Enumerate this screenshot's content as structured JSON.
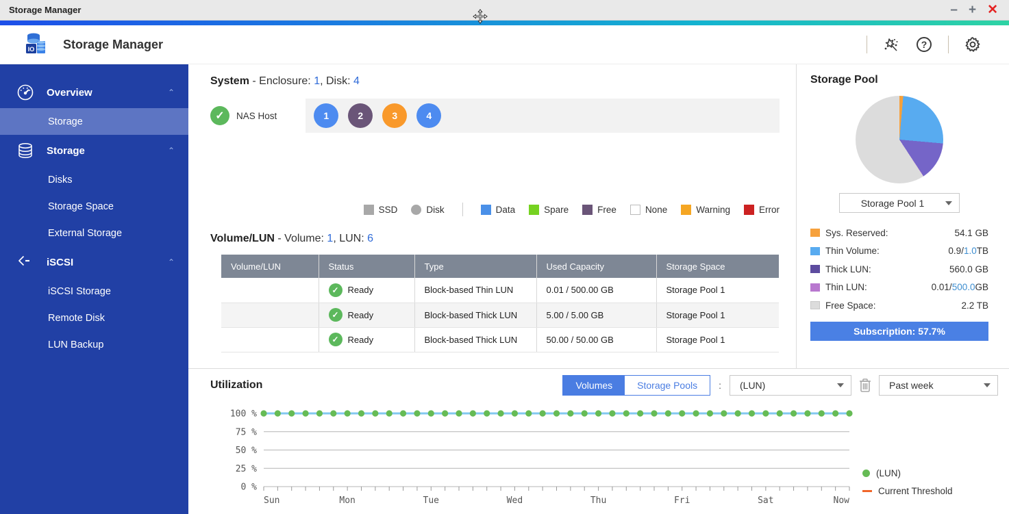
{
  "window": {
    "title": "Storage Manager",
    "controls": [
      {
        "name": "minimize",
        "glyph": "–"
      },
      {
        "name": "maximize",
        "glyph": "+"
      },
      {
        "name": "close",
        "glyph": "✕"
      }
    ]
  },
  "header": {
    "app_title": "Storage Manager",
    "help_glyph": "?",
    "icons": [
      "wizard-icon",
      "help-icon",
      "settings-icon"
    ]
  },
  "sidebar": {
    "bg_color": "#2140a5",
    "selected_color": "#5d75c3",
    "sections": [
      {
        "label": "Overview",
        "icon": "gauge-icon",
        "expanded": true,
        "children": [
          {
            "label": "Storage",
            "selected": true
          }
        ]
      },
      {
        "label": "Storage",
        "icon": "disks-icon",
        "expanded": true,
        "children": [
          {
            "label": "Disks",
            "selected": false
          },
          {
            "label": "Storage Space",
            "selected": false
          },
          {
            "label": "External Storage",
            "selected": false
          }
        ]
      },
      {
        "label": "iSCSI",
        "icon": "iscsi-icon",
        "expanded": true,
        "children": [
          {
            "label": "iSCSI Storage",
            "selected": false
          },
          {
            "label": "Remote Disk",
            "selected": false
          },
          {
            "label": "LUN Backup",
            "selected": false
          }
        ]
      }
    ]
  },
  "system": {
    "title": "System",
    "subtitle_prefix": " - Enclosure: ",
    "enclosure_count": "1",
    "disk_label": ", Disk: ",
    "disk_count": "4",
    "nas_host_label": "NAS Host",
    "nas_host_status_ok": "✓",
    "disks": [
      {
        "number": "1",
        "color": "#4d8bf0"
      },
      {
        "number": "2",
        "color": "#6a5578"
      },
      {
        "number": "3",
        "color": "#f9992b"
      },
      {
        "number": "4",
        "color": "#4d8bf0"
      }
    ],
    "legend": [
      {
        "label": "SSD",
        "shape": "square",
        "color": "#a8a8a8",
        "border": ""
      },
      {
        "label": "Disk",
        "shape": "circle",
        "color": "#a8a8a8",
        "border": ""
      },
      {
        "label": "Data",
        "shape": "square",
        "color": "#4a90e8",
        "border": "",
        "divider_before": true
      },
      {
        "label": "Spare",
        "shape": "square",
        "color": "#76d221",
        "border": ""
      },
      {
        "label": "Free",
        "shape": "square",
        "color": "#6a5578",
        "border": ""
      },
      {
        "label": "None",
        "shape": "square",
        "color": "#ffffff",
        "border": "#bbbbbb"
      },
      {
        "label": "Warning",
        "shape": "square",
        "color": "#f5a623",
        "border": ""
      },
      {
        "label": "Error",
        "shape": "square",
        "color": "#cc2222",
        "border": ""
      }
    ]
  },
  "volume_lun": {
    "title": "Volume/LUN",
    "subtitle_prefix": " - Volume: ",
    "volume_count": "1",
    "lun_label": ", LUN: ",
    "lun_count": "6",
    "table": {
      "columns": [
        "Volume/LUN",
        "Status",
        "Type",
        "Used Capacity",
        "Storage Space"
      ],
      "status_ok_glyph": "✓",
      "rows": [
        {
          "name": "",
          "status": "Ready",
          "type": "Block-based Thin LUN",
          "used": "0.01 / 500.00 GB",
          "space": "Storage Pool 1"
        },
        {
          "name": "",
          "status": "Ready",
          "type": "Block-based Thick LUN",
          "used": "5.00 / 5.00 GB",
          "space": "Storage Pool 1"
        },
        {
          "name": "",
          "status": "Ready",
          "type": "Block-based Thick LUN",
          "used": "50.00 / 50.00 GB",
          "space": "Storage Pool 1"
        }
      ]
    }
  },
  "storage_pool": {
    "title": "Storage Pool",
    "selector_value": "Storage Pool 1",
    "pie_slices": [
      {
        "name": "Sys. Reserved",
        "percent": 1.4,
        "color": "#f6a13c"
      },
      {
        "name": "Thin Volume",
        "percent": 25.0,
        "color": "#58abf0"
      },
      {
        "name": "Thick LUN",
        "percent": 14.3,
        "color": "#7565c8"
      },
      {
        "name": "Thin LUN",
        "percent": 0.1,
        "color": "#b878cf"
      },
      {
        "name": "Free Space",
        "percent": 59.2,
        "color": "#dcdcdc"
      }
    ],
    "legend": [
      {
        "label": "Sys. Reserved:",
        "color": "#f6a13c",
        "border": "",
        "value_parts": [
          {
            "text": "54.1 GB",
            "blue": false
          }
        ]
      },
      {
        "label": "Thin Volume:",
        "color": "#58abf0",
        "border": "",
        "value_parts": [
          {
            "text": "0.9/",
            "blue": false
          },
          {
            "text": "1.0",
            "blue": true
          },
          {
            "text": "TB",
            "blue": false
          }
        ]
      },
      {
        "label": "Thick LUN:",
        "color": "#5d4c9f",
        "border": "",
        "value_parts": [
          {
            "text": "560.0 GB",
            "blue": false
          }
        ]
      },
      {
        "label": "Thin LUN:",
        "color": "#b878cf",
        "border": "",
        "value_parts": [
          {
            "text": "0.01/",
            "blue": false
          },
          {
            "text": "500.0",
            "blue": true
          },
          {
            "text": "GB",
            "blue": false
          }
        ]
      },
      {
        "label": "Free Space:",
        "color": "#dcdcdc",
        "border": "#c8c8c8",
        "value_parts": [
          {
            "text": "2.2 TB",
            "blue": false
          }
        ]
      }
    ],
    "subscription_label": "Subscription: 57.7%"
  },
  "utilization": {
    "title": "Utilization",
    "toggle": [
      {
        "label": "Volumes",
        "active": true
      },
      {
        "label": "Storage Pools",
        "active": false
      }
    ],
    "colon": ":",
    "lun_select_value": "(LUN)",
    "period_select_value": "Past week"
  },
  "chart_data": {
    "type": "line",
    "title": "Utilization",
    "x_labels": [
      "Sun",
      "Mon",
      "Tue",
      "Wed",
      "Thu",
      "Fri",
      "Sat",
      "Now"
    ],
    "y_labels": [
      "100 %",
      "75 %",
      "50 %",
      "25 %",
      "0 %"
    ],
    "ylim": [
      0,
      100
    ],
    "grid": true,
    "grid_color": "#b4b4b4",
    "series": [
      {
        "name": "(LUN)",
        "dot_color": "#66bb55",
        "line_color": "#82c8f0",
        "values": [
          100,
          100,
          100,
          100,
          100,
          100,
          100,
          100,
          100,
          100,
          100,
          100,
          100,
          100,
          100,
          100,
          100,
          100,
          100,
          100,
          100,
          100,
          100,
          100,
          100,
          100,
          100,
          100,
          100,
          100,
          100,
          100,
          100,
          100,
          100,
          100,
          100,
          100,
          100,
          100,
          100,
          100,
          100
        ]
      }
    ],
    "threshold": {
      "name": "Current Threshold",
      "color": "#f0662a"
    },
    "legend_position": "right"
  }
}
